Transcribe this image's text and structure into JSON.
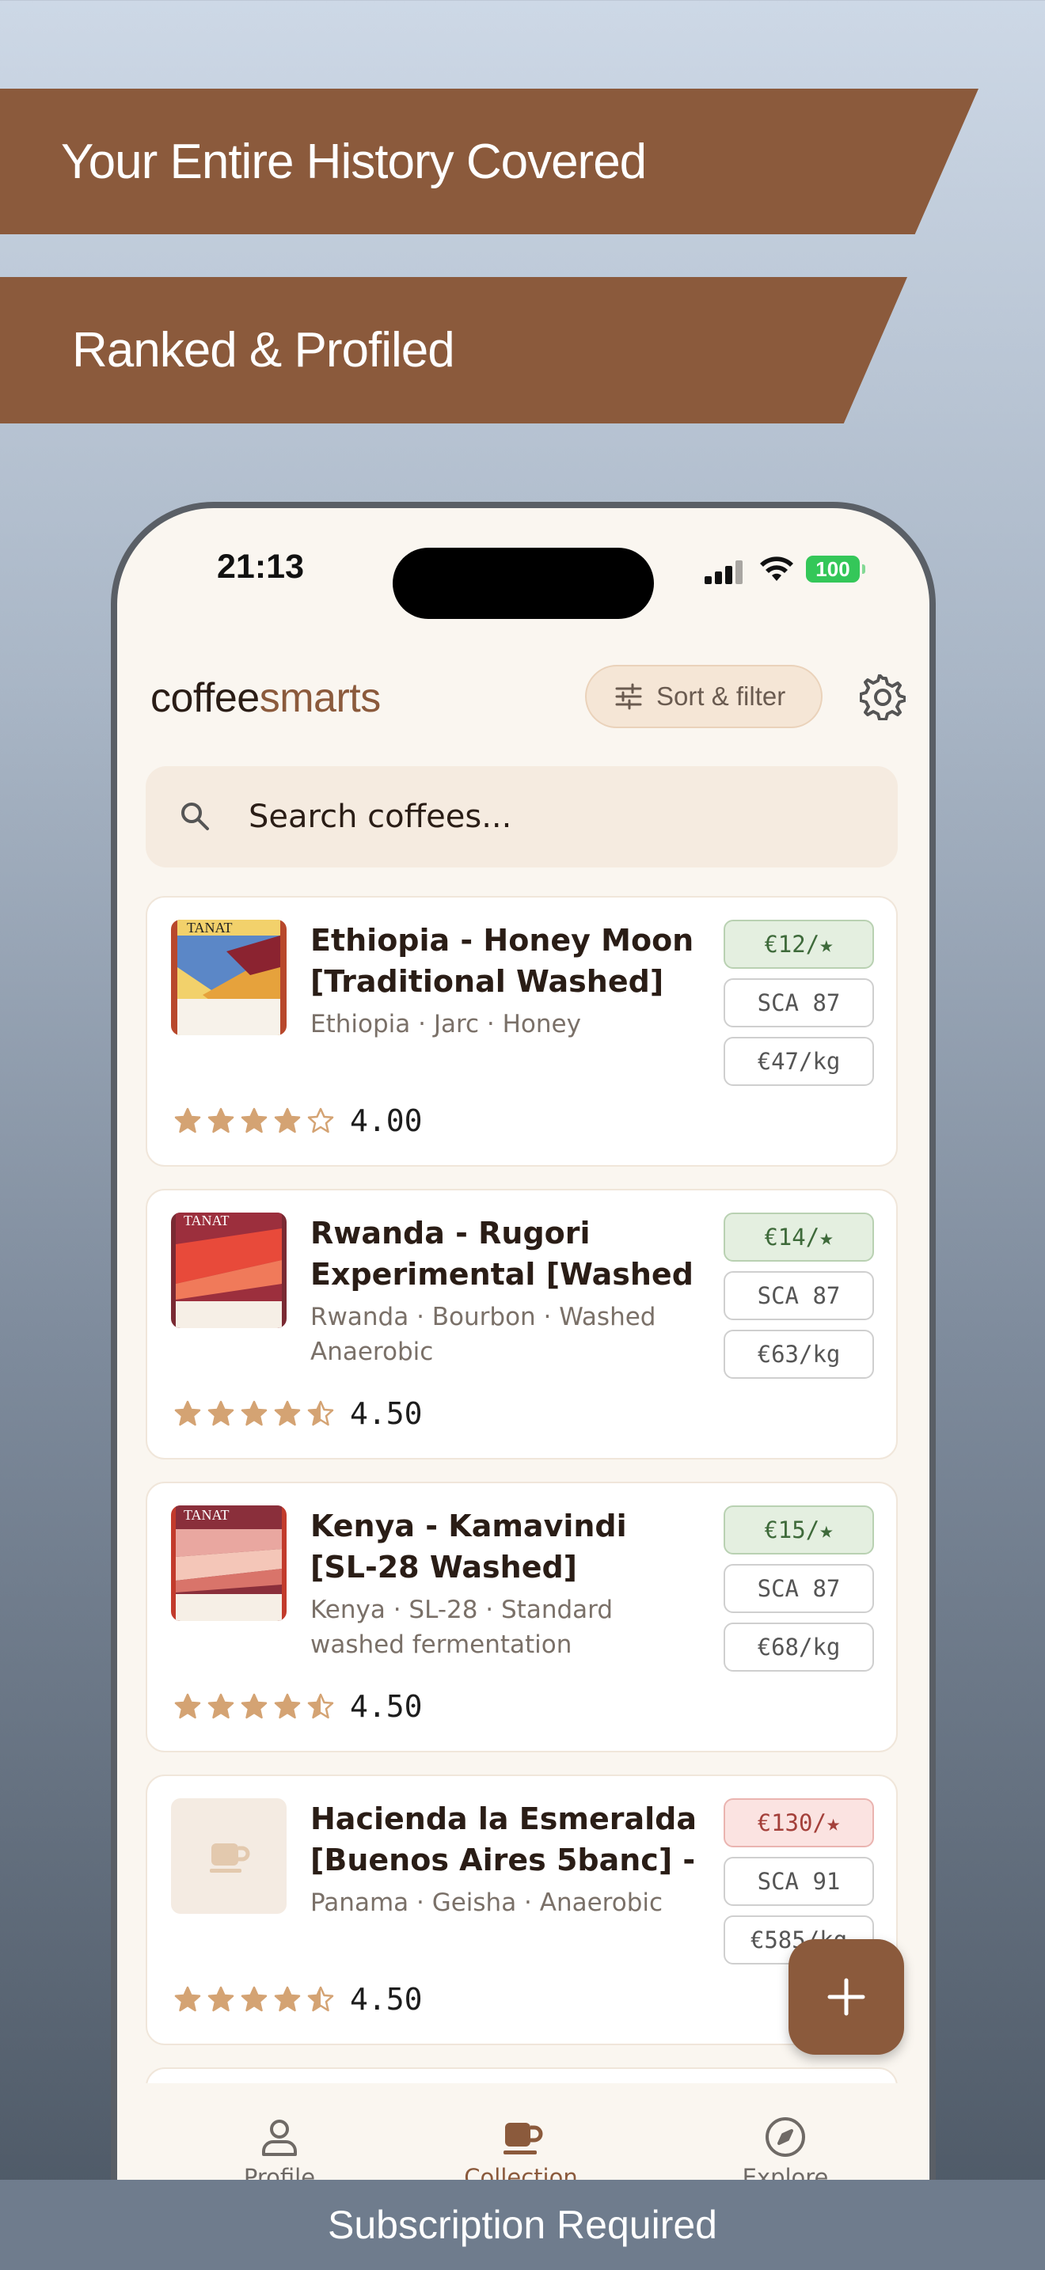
{
  "banners": {
    "top": "Your Entire History Covered",
    "second": "Ranked & Profiled"
  },
  "status_bar": {
    "time": "21:13",
    "battery": "100"
  },
  "app": {
    "logo_dark": "coffee",
    "logo_accent": "smarts",
    "sort_filter_label": "Sort & filter",
    "search_placeholder": "Search coffees..."
  },
  "colors": {
    "brand": "#8b5a3c",
    "background": "#faf6f0",
    "star": "#d4a373",
    "value_good": "#3e6a3a",
    "value_bad": "#a4403a"
  },
  "coffees": [
    {
      "title": "Ethiopia - Honey Moon [Traditional Washed]",
      "meta": "Ethiopia · Jarc · Honey",
      "price_per_star": "€12/★",
      "price_rating": "good",
      "sca": "SCA 87",
      "price_per_kg": "€47/kg",
      "stars": 4,
      "rating": "4.00",
      "image": "tanat-bag-yellow"
    },
    {
      "title": "Rwanda - Rugori Experimental [Washed A…",
      "meta": "Rwanda · Bourbon · Washed Anaerobic",
      "price_per_star": "€14/★",
      "price_rating": "good",
      "sca": "SCA 87",
      "price_per_kg": "€63/kg",
      "stars": 4.5,
      "rating": "4.50",
      "image": "tanat-bag-red"
    },
    {
      "title": "Kenya - Kamavindi [SL-28 Washed]",
      "meta": "Kenya · SL-28 · Standard washed fermentation",
      "price_per_star": "€15/★",
      "price_rating": "good",
      "sca": "SCA 87",
      "price_per_kg": "€68/kg",
      "stars": 4.5,
      "rating": "4.50",
      "image": "tanat-bag-pink"
    },
    {
      "title": "Hacienda la Esmeralda [Buenos Aires 5banc] -",
      "meta": "Panama · Geisha · Anaerobic",
      "price_per_star": "€130/★",
      "price_rating": "bad",
      "sca": "SCA 91",
      "price_per_kg": "€585/kg",
      "stars": 4.5,
      "rating": "4.50",
      "image": "coffee-cup-placeholder-icon"
    }
  ],
  "tabs": [
    {
      "label": "Profile",
      "icon": "person-icon",
      "active": false
    },
    {
      "label": "Collection",
      "icon": "coffee-cup-icon",
      "active": true
    },
    {
      "label": "Explore",
      "icon": "compass-icon",
      "active": false
    }
  ],
  "fab_label": "+",
  "footer": "Subscription Required"
}
